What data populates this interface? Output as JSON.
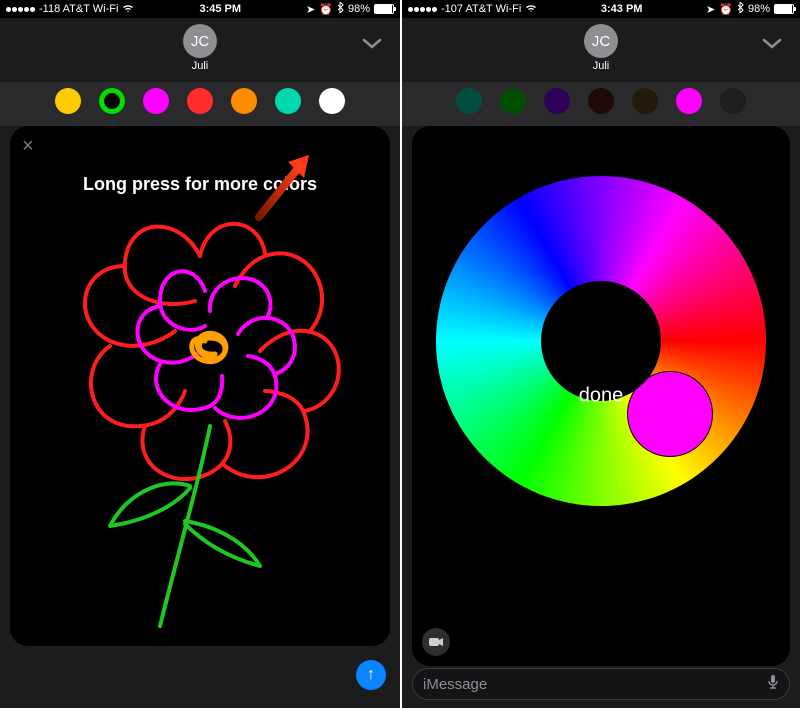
{
  "left": {
    "status": {
      "signal_text": "-118 AT&T Wi-Fi",
      "time": "3:45 PM",
      "battery_pct": "98%"
    },
    "header": {
      "avatar_initials": "JC",
      "contact_name": "Juli"
    },
    "palette": [
      {
        "name": "yellow",
        "hex": "#ffcc00"
      },
      {
        "name": "green",
        "hex": "#00e000",
        "selected": true
      },
      {
        "name": "magenta",
        "hex": "#ff00ff"
      },
      {
        "name": "red",
        "hex": "#ff2d2d"
      },
      {
        "name": "orange",
        "hex": "#ff8c00"
      },
      {
        "name": "teal",
        "hex": "#00d8b0"
      },
      {
        "name": "white",
        "hex": "#ffffff"
      }
    ],
    "annotation": "Long press for more colors",
    "close_label": "×",
    "send_glyph": "↑"
  },
  "right": {
    "status": {
      "signal_text": "-107 AT&T Wi-Fi",
      "time": "3:43 PM",
      "battery_pct": "98%"
    },
    "header": {
      "avatar_initials": "JC",
      "contact_name": "Juli"
    },
    "palette": [
      {
        "name": "teal",
        "hex": "#00d8b0"
      },
      {
        "name": "green",
        "hex": "#00e000"
      },
      {
        "name": "purple",
        "hex": "#8000ff"
      },
      {
        "name": "darkred",
        "hex": "#5a1a10"
      },
      {
        "name": "brown",
        "hex": "#6b4a1e"
      },
      {
        "name": "magenta",
        "hex": "#ff00ff",
        "active": true
      },
      {
        "name": "gray",
        "hex": "#555555"
      }
    ],
    "wheel": {
      "done_label": "done",
      "selected_hex": "#ff00ff"
    },
    "camera_glyph": "■",
    "input_placeholder": "iMessage",
    "mic_glyph": "🎤"
  }
}
